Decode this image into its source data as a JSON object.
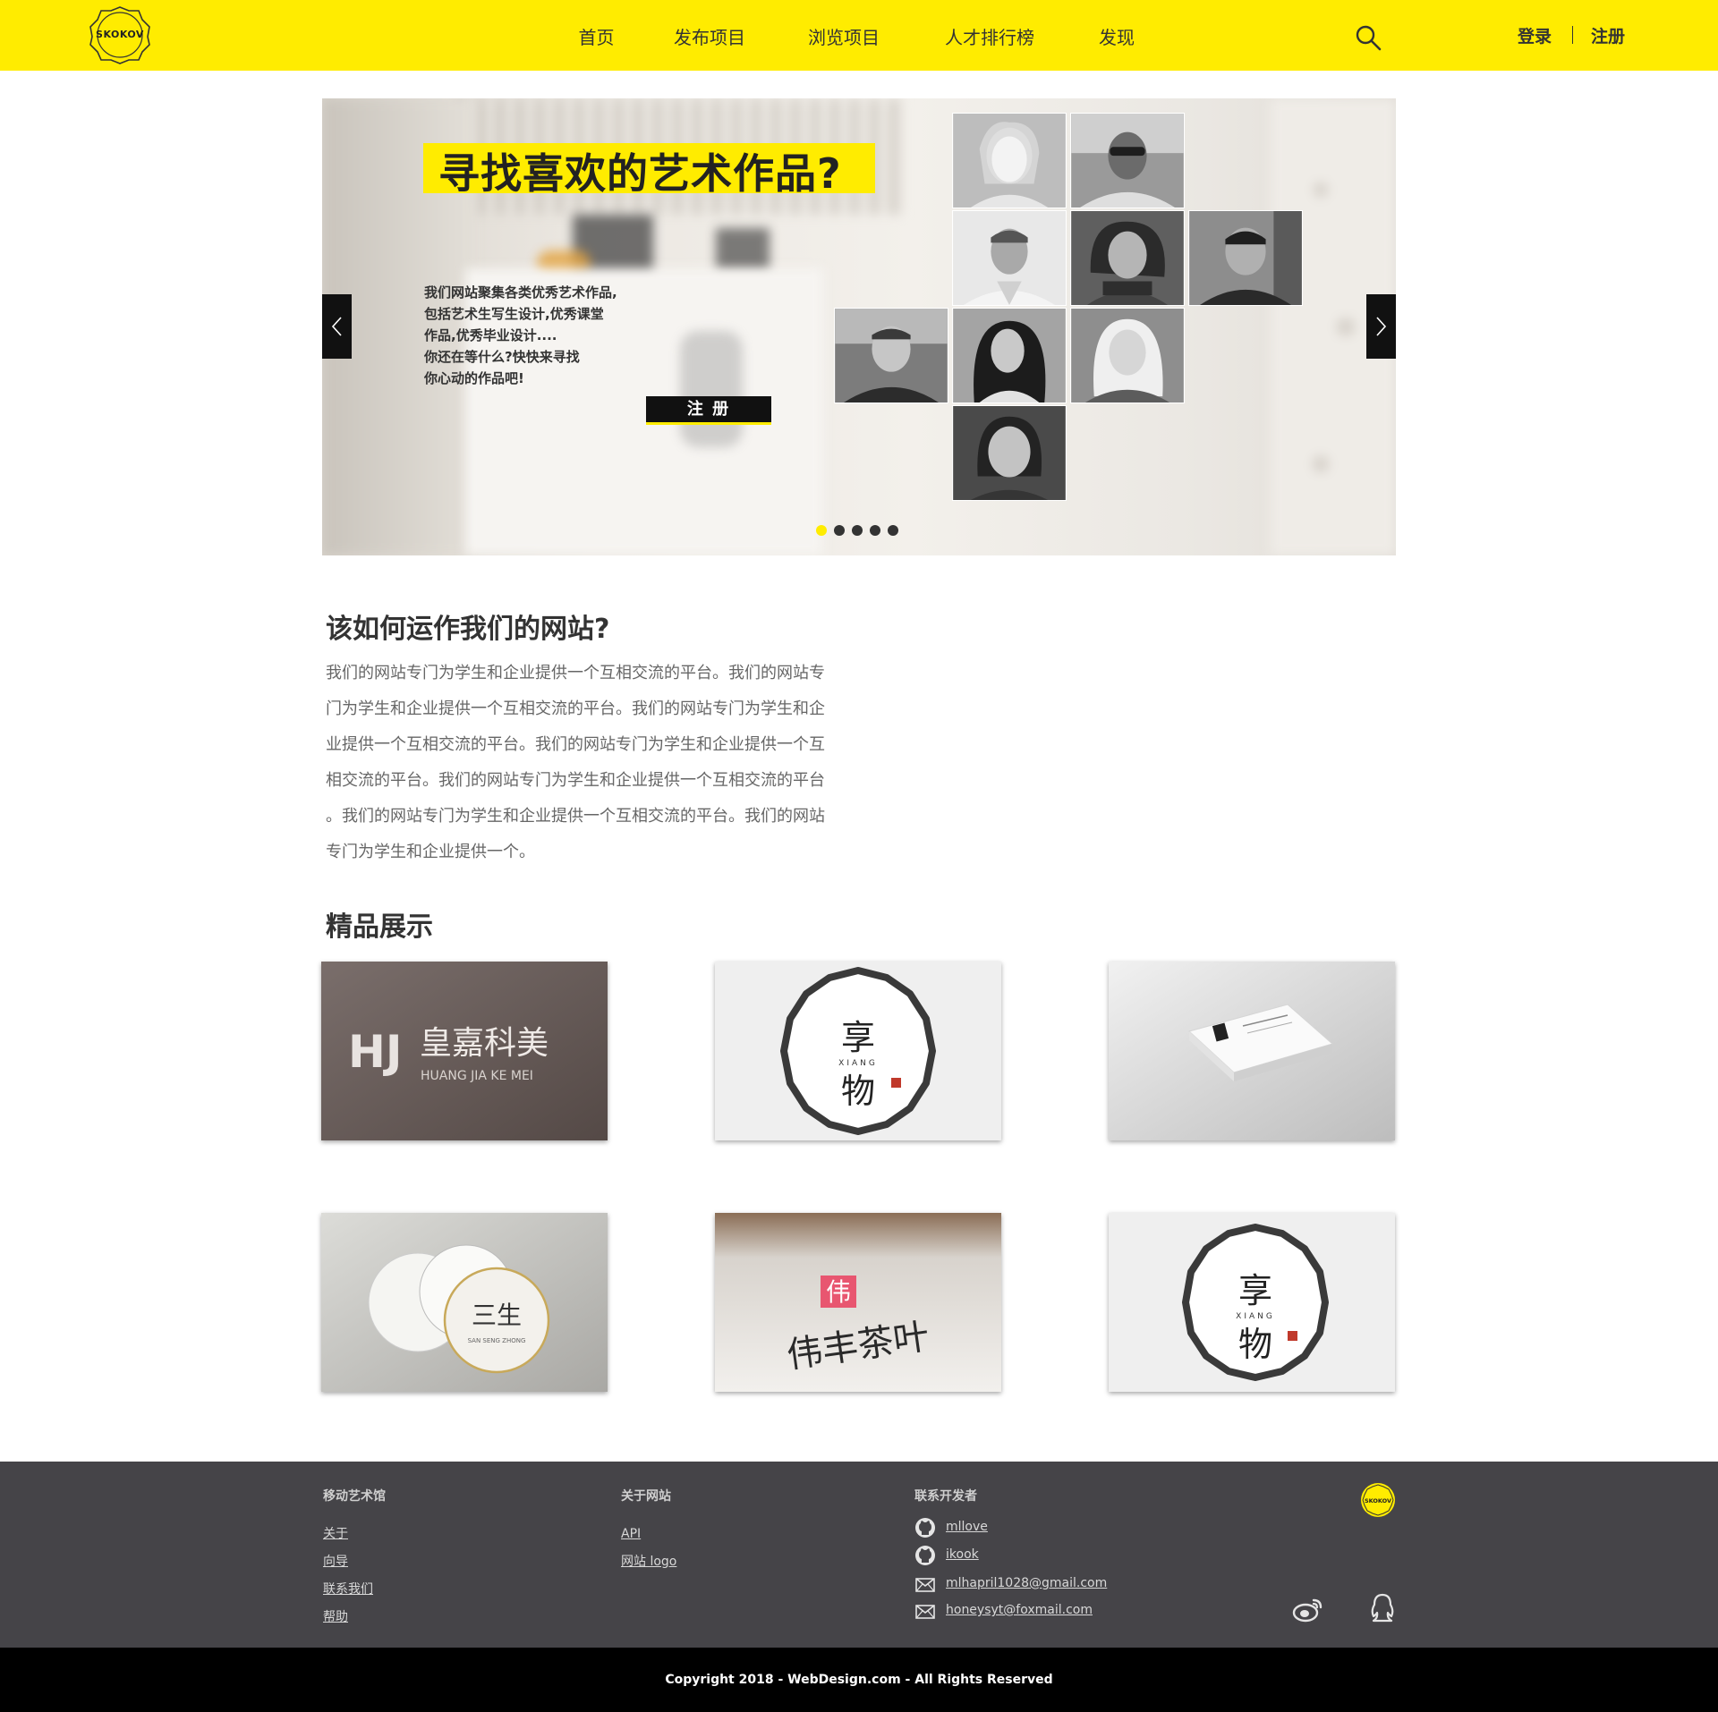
{
  "header": {
    "logo_text": "SKOKOV",
    "nav": [
      {
        "label": "首页",
        "active": true
      },
      {
        "label": "发布项目",
        "active": false
      },
      {
        "label": "浏览项目",
        "active": false
      },
      {
        "label": "人才排行榜",
        "active": false
      },
      {
        "label": "发现",
        "active": false
      }
    ],
    "login_label": "登录",
    "register_label": "注册",
    "search_icon": "search-icon"
  },
  "hero": {
    "title": "寻找喜欢的艺术作品?",
    "description_lines": [
      "我们网站聚集各类优秀艺术作品,",
      "包括艺术生写生设计,优秀课堂",
      "作品,优秀毕业设计....",
      "你还在等什么?快快来寻找",
      "你心动的作品吧!"
    ],
    "register_button": "注 册",
    "slide_count": 5,
    "active_slide": 1
  },
  "about": {
    "title": "该如何运作我们的网站?",
    "body_lines": [
      "我们的网站专门为学生和企业提供一个互相交流的平台。我们的网站专",
      "门为学生和企业提供一个互相交流的平台。我们的网站专门为学生和企",
      "业提供一个互相交流的平台。我们的网站专门为学生和企业提供一个互",
      "相交流的平台。我们的网站专门为学生和企业提供一个互相交流的平台",
      "。我们的网站专门为学生和企业提供一个互相交流的平台。我们的网站",
      "专门为学生和企业提供一个。"
    ]
  },
  "showcase": {
    "title": "精品展示",
    "items": [
      {
        "name": "皇嘉科美",
        "subtitle": "HUANG JIA KE MEI"
      },
      {
        "name": "享物",
        "subtitle": "XIANG"
      },
      {
        "name": "business card",
        "subtitle": ""
      },
      {
        "name": "三生",
        "subtitle": "SAN SENG ZHONG"
      },
      {
        "name": "伟丰茶叶",
        "subtitle": "伟"
      },
      {
        "name": "享物",
        "subtitle": "XIANG"
      }
    ]
  },
  "footer": {
    "col1": {
      "heading": "移动艺术馆",
      "links": [
        "关于",
        "向导",
        "联系我们",
        "帮助"
      ]
    },
    "col2": {
      "heading": "关于网站",
      "links": [
        "API",
        "网站 logo"
      ]
    },
    "col3": {
      "heading": "联系开发者",
      "contacts": [
        {
          "icon": "github-icon",
          "text": "mllove"
        },
        {
          "icon": "github-icon",
          "text": "ikook"
        },
        {
          "icon": "mail-icon",
          "text": "mlhapril1028@gmail.com"
        },
        {
          "icon": "mail-icon",
          "text": "honeysyt@foxmail.com"
        }
      ]
    },
    "logo_text": "SKOKOV",
    "social": [
      "weibo-icon",
      "qq-icon"
    ]
  },
  "copyright": "Copyright 2018 - WebDesign.com - All Rights Reserved",
  "colors": {
    "accent": "#ffec00",
    "dark": "#454448",
    "footer_bottom": "#000000"
  }
}
